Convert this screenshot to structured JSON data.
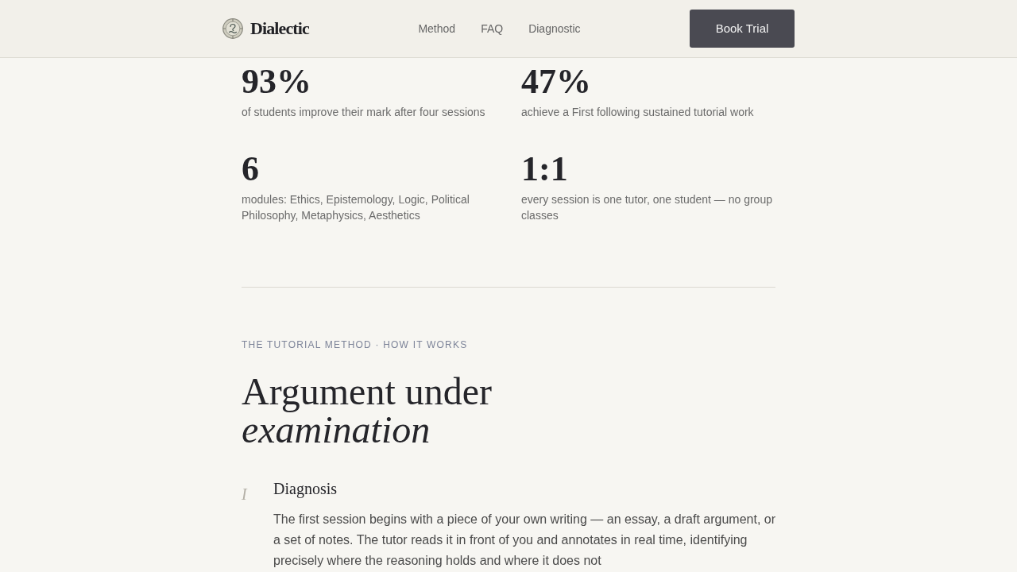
{
  "header": {
    "brand": "Dialectic",
    "nav": [
      {
        "label": "Method"
      },
      {
        "label": "FAQ"
      },
      {
        "label": "Diagnostic"
      }
    ],
    "cta": "Book Trial"
  },
  "stats": [
    {
      "value": "93%",
      "caption": "of students improve their mark after four sessions"
    },
    {
      "value": "47%",
      "caption": "achieve a First following sustained tutorial work"
    },
    {
      "value": "6",
      "caption": "modules: Ethics, Epistemology, Logic, Political Philosophy, Metaphysics, Aesthetics"
    },
    {
      "value": "1:1",
      "caption": "every session is one tutor, one student — no group classes"
    }
  ],
  "section": {
    "eyebrow": "THE TUTORIAL METHOD · HOW IT WORKS",
    "heading": "Argument under *examination*",
    "steps": [
      {
        "numeral": "I",
        "title": "Diagnosis",
        "body": "The first session begins with a piece of your own writing — an essay, a draft argument, or a set of notes. The tutor reads it in front of you and annotates in real time, identifying precisely where the reasoning holds and where it does not"
      }
    ]
  }
}
